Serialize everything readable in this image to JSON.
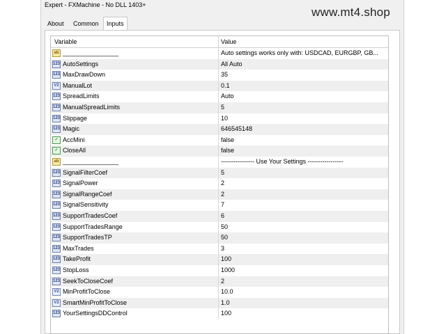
{
  "window": {
    "title": "Expert - FXMachine - No DLL 1403+"
  },
  "watermark": "www.mt4.shop",
  "tabs": [
    {
      "label": "About",
      "active": false
    },
    {
      "label": "Common",
      "active": false
    },
    {
      "label": "Inputs",
      "active": true
    }
  ],
  "grid": {
    "headers": {
      "variable": "Variable",
      "value": "Value"
    },
    "rows": [
      {
        "icon": "ab",
        "variable": "________________",
        "value": "Auto settings works only with: USDCAD, EURGBP, GB..."
      },
      {
        "icon": "123",
        "variable": "AutoSettings",
        "value": "All Auto"
      },
      {
        "icon": "123",
        "variable": "MaxDrawDown",
        "value": "35"
      },
      {
        "icon": "V2",
        "variable": "ManualLot",
        "value": "0.1"
      },
      {
        "icon": "123",
        "variable": "SpreadLimits",
        "value": "Auto"
      },
      {
        "icon": "123",
        "variable": "ManualSpreadLimits",
        "value": "5"
      },
      {
        "icon": "123",
        "variable": "Slippage",
        "value": "10"
      },
      {
        "icon": "123",
        "variable": "Magic",
        "value": "646545148"
      },
      {
        "icon": "bool",
        "variable": "AccMini",
        "value": "false"
      },
      {
        "icon": "bool",
        "variable": "CloseAll",
        "value": "false"
      },
      {
        "icon": "ab",
        "variable": "________________",
        "value": "---------------- Use Your Settings -----------------"
      },
      {
        "icon": "123",
        "variable": "SignalFilterCoef",
        "value": "5"
      },
      {
        "icon": "123",
        "variable": "SignalPower",
        "value": "2"
      },
      {
        "icon": "123",
        "variable": "SignalRangeCoef",
        "value": "2"
      },
      {
        "icon": "123",
        "variable": "SignalSensitivity",
        "value": "7"
      },
      {
        "icon": "123",
        "variable": "SupportTradesCoef",
        "value": "6"
      },
      {
        "icon": "123",
        "variable": "SupportTradesRange",
        "value": "50"
      },
      {
        "icon": "123",
        "variable": "SupportTradesTP",
        "value": "50"
      },
      {
        "icon": "123",
        "variable": "MaxTrades",
        "value": "3"
      },
      {
        "icon": "123",
        "variable": "TakeProfit",
        "value": "100"
      },
      {
        "icon": "123",
        "variable": "StopLoss",
        "value": "1000"
      },
      {
        "icon": "123",
        "variable": "SeekToCloseCoef",
        "value": "2"
      },
      {
        "icon": "V2",
        "variable": "MinProfitToClose",
        "value": "10.0"
      },
      {
        "icon": "V2",
        "variable": "SmartMinProfitToClose",
        "value": "1.0"
      },
      {
        "icon": "123",
        "variable": "YourSettingsDDControl",
        "value": "100"
      }
    ]
  }
}
